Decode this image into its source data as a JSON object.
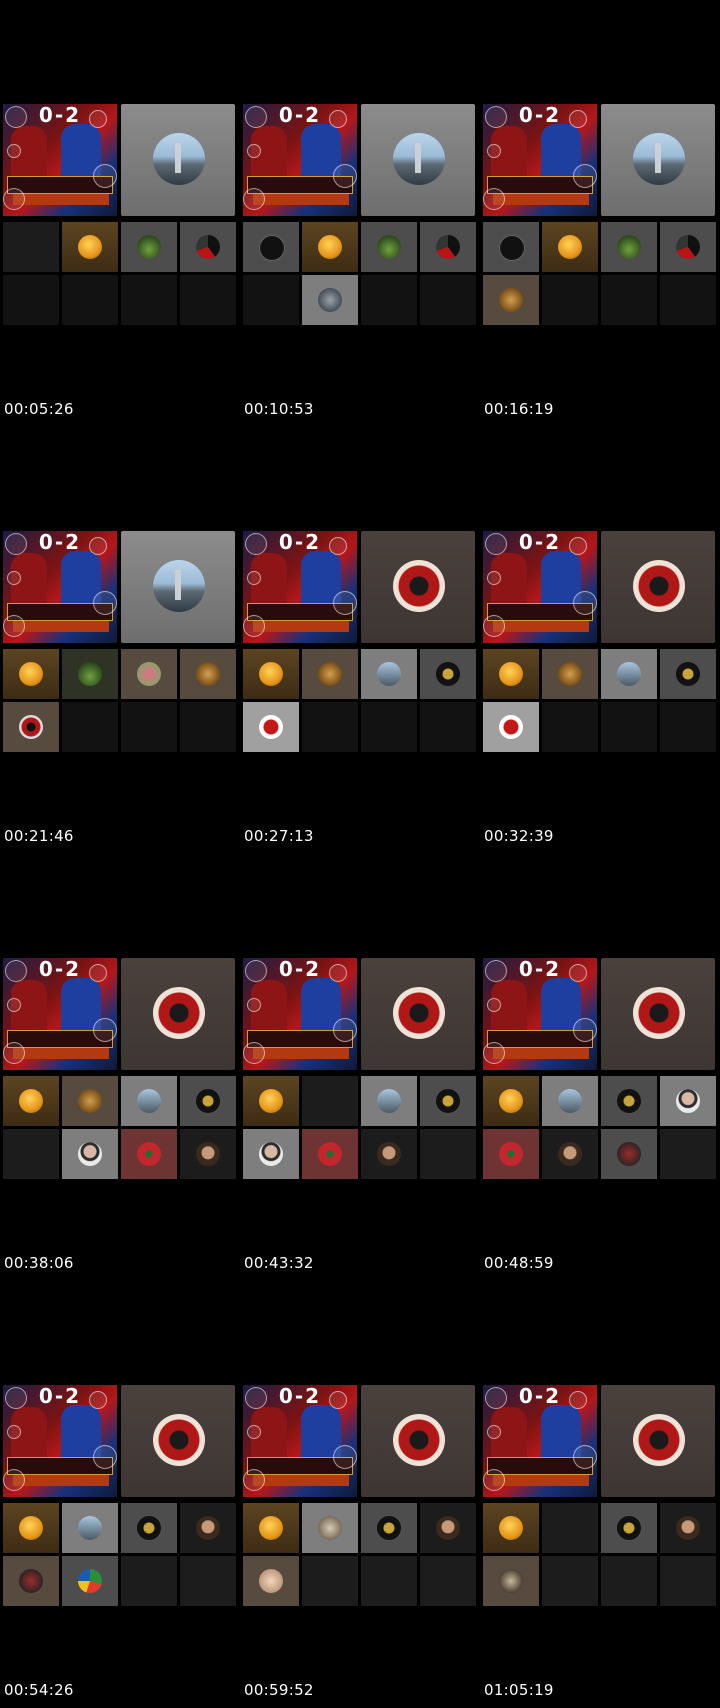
{
  "contact_sheet": {
    "columns": 3,
    "cells": [
      {
        "timestamp": "00:05:26",
        "host_bg": "gray",
        "host_avatar": "city",
        "slots": [
          "empty",
          "moon",
          "tree",
          "redblack",
          "empty",
          "empty",
          "empty",
          "empty"
        ],
        "slot_bgs": [
          "dark",
          "gold",
          "gray",
          "gray",
          "empty",
          "empty",
          "empty",
          "empty"
        ]
      },
      {
        "timestamp": "00:10:53",
        "host_bg": "gray",
        "host_avatar": "city",
        "slots": [
          "mohamed",
          "moon",
          "tree",
          "redblack",
          "empty",
          "robot",
          "empty",
          "empty"
        ],
        "slot_bgs": [
          "gray",
          "gold",
          "gray",
          "gray",
          "empty",
          "light",
          "empty",
          "empty"
        ]
      },
      {
        "timestamp": "00:16:19",
        "host_bg": "gray",
        "host_avatar": "city",
        "slots": [
          "mohamed",
          "moon",
          "tree",
          "redblack",
          "tiger",
          "empty",
          "empty",
          "empty"
        ],
        "slot_bgs": [
          "gray",
          "gold",
          "gray",
          "gray",
          "brown",
          "empty",
          "empty",
          "empty"
        ]
      },
      {
        "timestamp": "00:21:46",
        "host_bg": "gray",
        "host_avatar": "city",
        "slots": [
          "moon",
          "tree",
          "flower",
          "tiger",
          "mini-warrior",
          "empty",
          "empty",
          "empty"
        ],
        "slot_bgs": [
          "gold",
          "olive",
          "brown",
          "brown",
          "brown",
          "empty",
          "empty",
          "empty"
        ]
      },
      {
        "timestamp": "00:27:13",
        "host_bg": "brown",
        "host_avatar": "warrior",
        "slots": [
          "moon",
          "tiger",
          "city",
          "callig",
          "spider",
          "empty",
          "empty",
          "empty"
        ],
        "slot_bgs": [
          "gold",
          "brown",
          "light",
          "gray",
          "white",
          "empty",
          "empty",
          "empty"
        ]
      },
      {
        "timestamp": "00:32:39",
        "host_bg": "brown",
        "host_avatar": "warrior",
        "slots": [
          "moon",
          "tiger",
          "city",
          "callig",
          "spider",
          "empty",
          "empty",
          "empty"
        ],
        "slot_bgs": [
          "gold",
          "brown",
          "light",
          "gray",
          "white",
          "empty",
          "empty",
          "empty"
        ]
      },
      {
        "timestamp": "00:38:06",
        "host_bg": "brown",
        "host_avatar": "warrior",
        "slots": [
          "moon",
          "tiger",
          "city",
          "callig",
          "empty",
          "woman",
          "flag",
          "man"
        ],
        "slot_bgs": [
          "gold",
          "brown",
          "light",
          "gray",
          "dark",
          "light",
          "red",
          "dark"
        ]
      },
      {
        "timestamp": "00:43:32",
        "host_bg": "brown",
        "host_avatar": "warrior",
        "slots": [
          "moon",
          "empty",
          "city",
          "callig",
          "woman",
          "flag",
          "man",
          "empty"
        ],
        "slot_bgs": [
          "gold",
          "dark",
          "light",
          "gray",
          "light",
          "red",
          "dark",
          "dark"
        ]
      },
      {
        "timestamp": "00:48:59",
        "host_bg": "brown",
        "host_avatar": "warrior",
        "slots": [
          "moon",
          "city",
          "callig",
          "woman",
          "flag",
          "man",
          "girl",
          "empty"
        ],
        "slot_bgs": [
          "gold",
          "light",
          "gray",
          "light",
          "red",
          "dark",
          "gray",
          "dark"
        ]
      },
      {
        "timestamp": "00:54:26",
        "host_bg": "brown",
        "host_avatar": "warrior",
        "slots": [
          "moon",
          "city",
          "callig",
          "man",
          "girl",
          "parrot",
          "empty",
          "empty"
        ],
        "slot_bgs": [
          "gold",
          "light",
          "gray",
          "dark",
          "brown",
          "gray",
          "dark",
          "dark"
        ]
      },
      {
        "timestamp": "00:59:52",
        "host_bg": "brown",
        "host_avatar": "warrior",
        "slots": [
          "moon",
          "stone",
          "callig",
          "man",
          "baby",
          "empty",
          "empty",
          "empty"
        ],
        "slot_bgs": [
          "gold",
          "light",
          "gray",
          "dark",
          "brown",
          "dark",
          "dark",
          "dark"
        ]
      },
      {
        "timestamp": "01:05:19",
        "host_bg": "brown",
        "host_avatar": "warrior",
        "slots": [
          "moon",
          "empty",
          "callig",
          "man",
          "skull",
          "empty",
          "empty",
          "empty"
        ],
        "slot_bgs": [
          "gold",
          "dark",
          "gray",
          "dark",
          "brown",
          "dark",
          "dark",
          "dark"
        ]
      }
    ],
    "poster": {
      "score": "0-2"
    }
  }
}
